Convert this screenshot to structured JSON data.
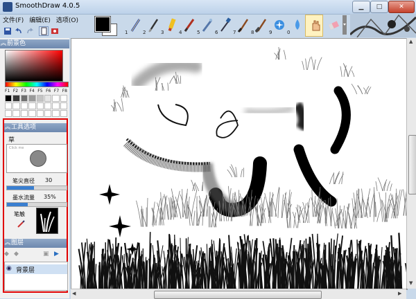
{
  "window": {
    "title": "SmoothDraw 4.0.5",
    "min": "▁",
    "max": "□",
    "close": "✕"
  },
  "menu": [
    "文件(F)",
    "编辑(E)",
    "选项(O)"
  ],
  "brush_numbers": [
    "1",
    "2",
    "3",
    "4",
    "5",
    "6",
    "7",
    "8",
    "9",
    "0"
  ],
  "brush_icons": [
    "pencil-icon",
    "pen-icon",
    "highlighter-icon",
    "marker-icon",
    "airbrush-icon",
    "dropper-icon",
    "brush-icon",
    "grass-brush-icon",
    "sparkle-brush-icon",
    "water-icon",
    "hand-icon",
    "eraser-icon"
  ],
  "panels": {
    "foreground": "前景色",
    "tool_options": "工具选项",
    "layers": "图层"
  },
  "palette_labels": [
    "F1",
    "F2",
    "F3",
    "F4",
    "F5",
    "F6",
    "F7",
    "F8"
  ],
  "palette_colors": [
    "#000000",
    "#3a3a3a",
    "#6f6f6f",
    "#9a9a9a",
    "#c4c4c4",
    "#e6e6e6",
    "#ffffff",
    "#ffffff",
    "#ffffff",
    "#ffffff",
    "#ffffff",
    "#ffffff",
    "#ffffff",
    "#ffffff",
    "#ffffff",
    "#ffffff",
    "#ffffff",
    "#ffffff",
    "#ffffff",
    "#ffffff",
    "#ffffff",
    "#ffffff",
    "#ffffff",
    "#ffffff"
  ],
  "tool": {
    "brush_name": "草",
    "preview_hint": "Click me",
    "tip_size_label": "笔尖直径",
    "tip_size_value": "30",
    "tip_size_frac": 0.45,
    "ink_flow_label": "墨水流量",
    "ink_flow_value": "35%",
    "ink_flow_frac": 0.35,
    "nib_label": "笔触"
  },
  "layers": {
    "items": [
      {
        "name": "背景层"
      }
    ]
  }
}
